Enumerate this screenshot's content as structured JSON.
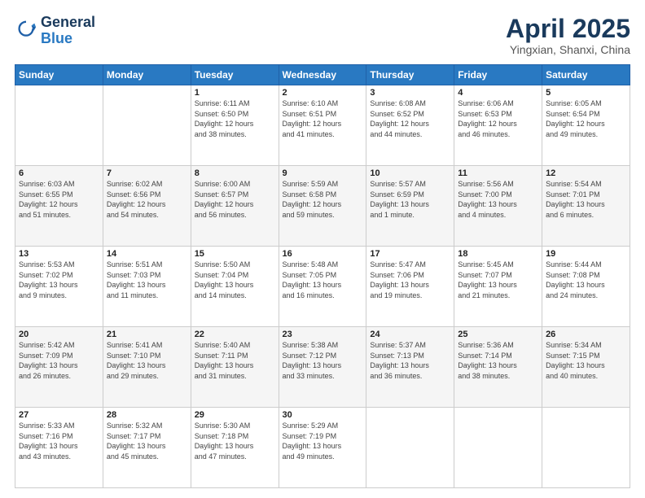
{
  "header": {
    "logo_line1": "General",
    "logo_line2": "Blue",
    "month_title": "April 2025",
    "location": "Yingxian, Shanxi, China"
  },
  "days_of_week": [
    "Sunday",
    "Monday",
    "Tuesday",
    "Wednesday",
    "Thursday",
    "Friday",
    "Saturday"
  ],
  "weeks": [
    [
      {
        "day": "",
        "info": ""
      },
      {
        "day": "",
        "info": ""
      },
      {
        "day": "1",
        "info": "Sunrise: 6:11 AM\nSunset: 6:50 PM\nDaylight: 12 hours\nand 38 minutes."
      },
      {
        "day": "2",
        "info": "Sunrise: 6:10 AM\nSunset: 6:51 PM\nDaylight: 12 hours\nand 41 minutes."
      },
      {
        "day": "3",
        "info": "Sunrise: 6:08 AM\nSunset: 6:52 PM\nDaylight: 12 hours\nand 44 minutes."
      },
      {
        "day": "4",
        "info": "Sunrise: 6:06 AM\nSunset: 6:53 PM\nDaylight: 12 hours\nand 46 minutes."
      },
      {
        "day": "5",
        "info": "Sunrise: 6:05 AM\nSunset: 6:54 PM\nDaylight: 12 hours\nand 49 minutes."
      }
    ],
    [
      {
        "day": "6",
        "info": "Sunrise: 6:03 AM\nSunset: 6:55 PM\nDaylight: 12 hours\nand 51 minutes."
      },
      {
        "day": "7",
        "info": "Sunrise: 6:02 AM\nSunset: 6:56 PM\nDaylight: 12 hours\nand 54 minutes."
      },
      {
        "day": "8",
        "info": "Sunrise: 6:00 AM\nSunset: 6:57 PM\nDaylight: 12 hours\nand 56 minutes."
      },
      {
        "day": "9",
        "info": "Sunrise: 5:59 AM\nSunset: 6:58 PM\nDaylight: 12 hours\nand 59 minutes."
      },
      {
        "day": "10",
        "info": "Sunrise: 5:57 AM\nSunset: 6:59 PM\nDaylight: 13 hours\nand 1 minute."
      },
      {
        "day": "11",
        "info": "Sunrise: 5:56 AM\nSunset: 7:00 PM\nDaylight: 13 hours\nand 4 minutes."
      },
      {
        "day": "12",
        "info": "Sunrise: 5:54 AM\nSunset: 7:01 PM\nDaylight: 13 hours\nand 6 minutes."
      }
    ],
    [
      {
        "day": "13",
        "info": "Sunrise: 5:53 AM\nSunset: 7:02 PM\nDaylight: 13 hours\nand 9 minutes."
      },
      {
        "day": "14",
        "info": "Sunrise: 5:51 AM\nSunset: 7:03 PM\nDaylight: 13 hours\nand 11 minutes."
      },
      {
        "day": "15",
        "info": "Sunrise: 5:50 AM\nSunset: 7:04 PM\nDaylight: 13 hours\nand 14 minutes."
      },
      {
        "day": "16",
        "info": "Sunrise: 5:48 AM\nSunset: 7:05 PM\nDaylight: 13 hours\nand 16 minutes."
      },
      {
        "day": "17",
        "info": "Sunrise: 5:47 AM\nSunset: 7:06 PM\nDaylight: 13 hours\nand 19 minutes."
      },
      {
        "day": "18",
        "info": "Sunrise: 5:45 AM\nSunset: 7:07 PM\nDaylight: 13 hours\nand 21 minutes."
      },
      {
        "day": "19",
        "info": "Sunrise: 5:44 AM\nSunset: 7:08 PM\nDaylight: 13 hours\nand 24 minutes."
      }
    ],
    [
      {
        "day": "20",
        "info": "Sunrise: 5:42 AM\nSunset: 7:09 PM\nDaylight: 13 hours\nand 26 minutes."
      },
      {
        "day": "21",
        "info": "Sunrise: 5:41 AM\nSunset: 7:10 PM\nDaylight: 13 hours\nand 29 minutes."
      },
      {
        "day": "22",
        "info": "Sunrise: 5:40 AM\nSunset: 7:11 PM\nDaylight: 13 hours\nand 31 minutes."
      },
      {
        "day": "23",
        "info": "Sunrise: 5:38 AM\nSunset: 7:12 PM\nDaylight: 13 hours\nand 33 minutes."
      },
      {
        "day": "24",
        "info": "Sunrise: 5:37 AM\nSunset: 7:13 PM\nDaylight: 13 hours\nand 36 minutes."
      },
      {
        "day": "25",
        "info": "Sunrise: 5:36 AM\nSunset: 7:14 PM\nDaylight: 13 hours\nand 38 minutes."
      },
      {
        "day": "26",
        "info": "Sunrise: 5:34 AM\nSunset: 7:15 PM\nDaylight: 13 hours\nand 40 minutes."
      }
    ],
    [
      {
        "day": "27",
        "info": "Sunrise: 5:33 AM\nSunset: 7:16 PM\nDaylight: 13 hours\nand 43 minutes."
      },
      {
        "day": "28",
        "info": "Sunrise: 5:32 AM\nSunset: 7:17 PM\nDaylight: 13 hours\nand 45 minutes."
      },
      {
        "day": "29",
        "info": "Sunrise: 5:30 AM\nSunset: 7:18 PM\nDaylight: 13 hours\nand 47 minutes."
      },
      {
        "day": "30",
        "info": "Sunrise: 5:29 AM\nSunset: 7:19 PM\nDaylight: 13 hours\nand 49 minutes."
      },
      {
        "day": "",
        "info": ""
      },
      {
        "day": "",
        "info": ""
      },
      {
        "day": "",
        "info": ""
      }
    ]
  ]
}
